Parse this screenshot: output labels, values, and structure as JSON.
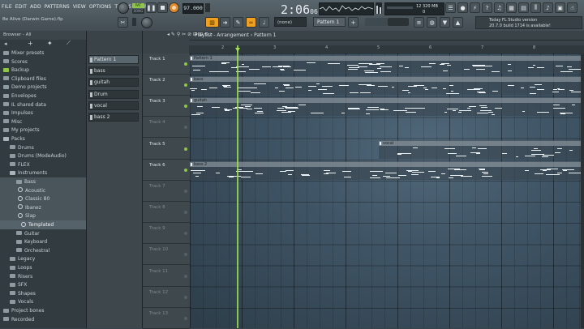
{
  "menu": [
    "FILE",
    "EDIT",
    "ADD",
    "PATTERNS",
    "VIEW",
    "OPTIONS",
    "TOOLS",
    "HELP"
  ],
  "project_title": "Be Alive (Darwin Game).flp",
  "transport": {
    "pat_label": "PAT",
    "song_label": "SONG",
    "tempo": "97.000",
    "time_main": "2:06",
    "time_sub": "06"
  },
  "cpu": {
    "cores": "12",
    "memory": "320 MB",
    "voices": "0"
  },
  "toolbar": {
    "none_select": "(none)",
    "pattern_select": "Pattern 1"
  },
  "news": {
    "line1": "Today  FL Studio version",
    "line2": "20.7.0 build 1714 is available!"
  },
  "browser": {
    "header": "Browser - All",
    "items": [
      {
        "label": "Mixer presets",
        "kind": "folder"
      },
      {
        "label": "Scores",
        "kind": "score"
      },
      {
        "label": "Backup",
        "kind": "folder-green"
      },
      {
        "label": "Clipboard files",
        "kind": "folder"
      },
      {
        "label": "Demo projects",
        "kind": "folder"
      },
      {
        "label": "Envelopes",
        "kind": "folder"
      },
      {
        "label": "IL shared data",
        "kind": "folder"
      },
      {
        "label": "Impulses",
        "kind": "folder"
      },
      {
        "label": "Misc",
        "kind": "folder"
      },
      {
        "label": "My projects",
        "kind": "folder"
      },
      {
        "label": "Packs",
        "kind": "folder-open"
      },
      {
        "label": "Drums",
        "kind": "sub"
      },
      {
        "label": "Drums (ModeAudio)",
        "kind": "sub"
      },
      {
        "label": "FLEX",
        "kind": "sub"
      },
      {
        "label": "Instruments",
        "kind": "sub-open"
      },
      {
        "label": "Bass",
        "kind": "sub2"
      },
      {
        "label": "Acoustic",
        "kind": "gear"
      },
      {
        "label": "Classic 80",
        "kind": "gear"
      },
      {
        "label": "Ibanez",
        "kind": "gear"
      },
      {
        "label": "Slap",
        "kind": "gear"
      },
      {
        "label": "Templated",
        "kind": "gear-sel"
      },
      {
        "label": "Guitar",
        "kind": "sub2"
      },
      {
        "label": "Keyboard",
        "kind": "sub2"
      },
      {
        "label": "Orchestral",
        "kind": "sub2"
      },
      {
        "label": "Legacy",
        "kind": "sub"
      },
      {
        "label": "Loops",
        "kind": "sub"
      },
      {
        "label": "Risers",
        "kind": "sub"
      },
      {
        "label": "SFX",
        "kind": "sub"
      },
      {
        "label": "Shapes",
        "kind": "sub"
      },
      {
        "label": "Vocals",
        "kind": "sub"
      },
      {
        "label": "Project bones",
        "kind": "folder"
      },
      {
        "label": "Recorded",
        "kind": "folder"
      }
    ]
  },
  "patterns": [
    "Pattern 1",
    "bass",
    "guitah",
    "Drum",
    "vocal",
    "bass 2"
  ],
  "playlist": {
    "title": "Playlist - Arrangement",
    "current_pattern": "Pattern 1",
    "ruler": [
      "2",
      "3",
      "4",
      "5",
      "6",
      "7",
      "8"
    ],
    "tracks": [
      "Track 1",
      "Track 2",
      "Track 3",
      "Track 4",
      "Track 5",
      "Track 6",
      "Track 7",
      "Track 8",
      "Track 9",
      "Track 10",
      "Track 11",
      "Track 12",
      "Track 13"
    ],
    "clips": [
      {
        "track": 0,
        "label": "Pattern 1"
      },
      {
        "track": 1,
        "label": "bass"
      },
      {
        "track": 2,
        "label": "guitah"
      },
      {
        "track": 4,
        "label": "vocal"
      },
      {
        "track": 5,
        "label": "bass 2"
      }
    ]
  },
  "colors": {
    "accent": "#9be04a",
    "button_orange": "#f0a020",
    "bg": "#3a4349"
  }
}
